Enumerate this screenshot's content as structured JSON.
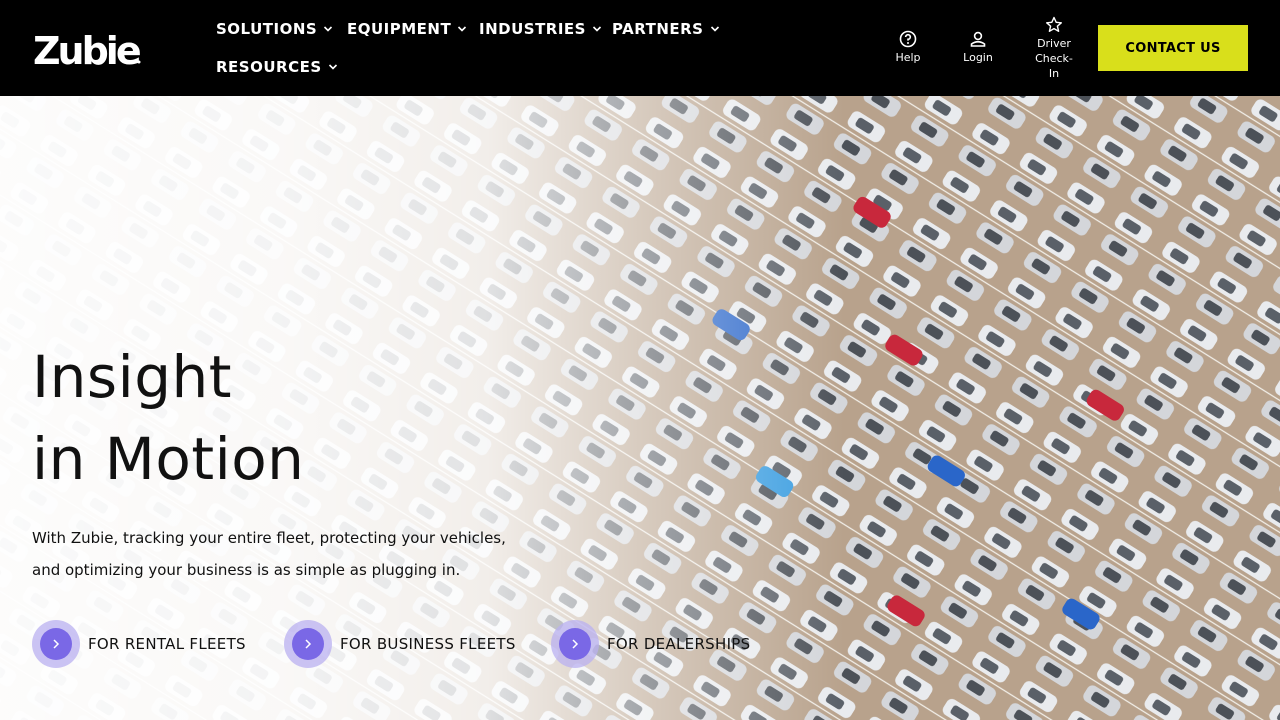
{
  "brand": {
    "logo_text": "Zubie",
    "accent_color": "#d9df1b",
    "cta_color": "#7a68e6"
  },
  "nav": {
    "items": [
      {
        "label": "SOLUTIONS",
        "icon": "chevron-down-icon"
      },
      {
        "label": "EQUIPMENT",
        "icon": "chevron-down-icon"
      },
      {
        "label": "INDUSTRIES",
        "icon": "chevron-down-icon"
      },
      {
        "label": "PARTNERS",
        "icon": "chevron-down-icon"
      },
      {
        "label": "RESOURCES",
        "icon": "chevron-down-icon"
      }
    ]
  },
  "utility": {
    "help": {
      "label": "Help",
      "icon": "help-circle-icon"
    },
    "login": {
      "label": "Login",
      "icon": "user-icon"
    },
    "driver": {
      "line1": "Driver",
      "line2": "Check-",
      "line3": "In",
      "icon": "star-icon"
    }
  },
  "contact_button": "CONTACT US",
  "hero": {
    "headline_line1": "Insight",
    "headline_line2": "in Motion",
    "subtext": "With Zubie, tracking your entire fleet, protecting your vehicles, and optimizing your business is as simple as plugging in.",
    "ctas": [
      {
        "label": "FOR RENTAL FLEETS",
        "icon": "chevron-right-icon"
      },
      {
        "label": "FOR BUSINESS FLEETS",
        "icon": "chevron-right-icon"
      },
      {
        "label": "FOR DEALERSHIPS",
        "icon": "chevron-right-icon"
      }
    ],
    "background": "parking-lot-aerial-photo"
  }
}
